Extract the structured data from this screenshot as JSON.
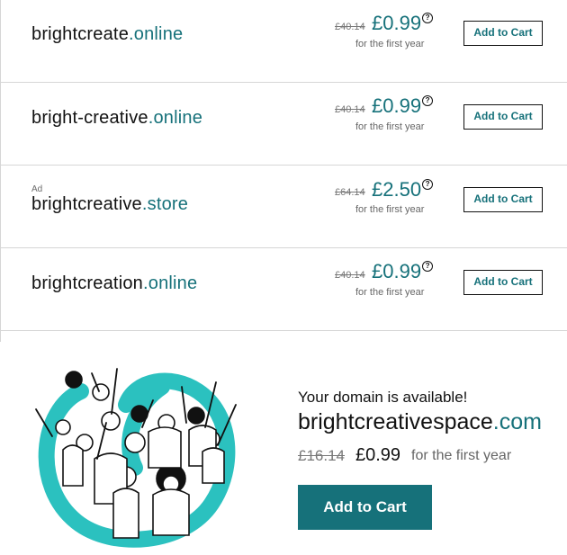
{
  "domains": [
    {
      "ad": "",
      "name": "brightcreate",
      "tld": ".online",
      "old_price": "£40.14",
      "price": "£0.99",
      "term": "for the first year",
      "button": "Add to Cart"
    },
    {
      "ad": "",
      "name": "bright-creative",
      "tld": ".online",
      "old_price": "£40.14",
      "price": "£0.99",
      "term": "for the first year",
      "button": "Add to Cart"
    },
    {
      "ad": "Ad",
      "name": "brightcreative",
      "tld": ".store",
      "old_price": "£64.14",
      "price": "£2.50",
      "term": "for the first year",
      "button": "Add to Cart"
    },
    {
      "ad": "",
      "name": "brightcreation",
      "tld": ".online",
      "old_price": "£40.14",
      "price": "£0.99",
      "term": "for the first year",
      "button": "Add to Cart"
    }
  ],
  "help_glyph": "?",
  "featured": {
    "headline": "Your domain is available!",
    "name": "brightcreativespace",
    "tld": ".com",
    "old_price": "£16.14",
    "price": "£0.99",
    "term": "for the first year",
    "button": "Add to Cart"
  },
  "colors": {
    "accent": "#16717a",
    "illustration": "#2bc1bf"
  }
}
